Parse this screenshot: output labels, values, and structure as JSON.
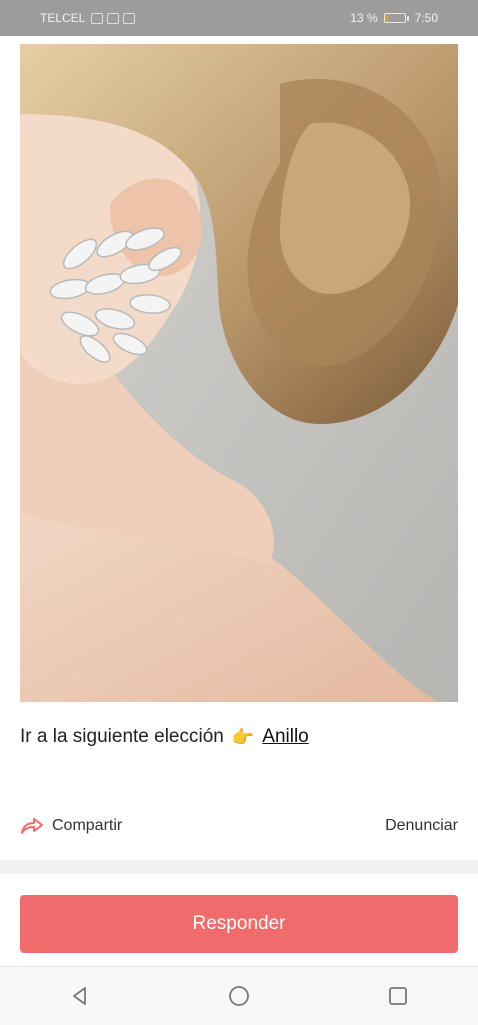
{
  "status_bar": {
    "carrier": "TELCEL",
    "battery_percent": "13 %",
    "battery_level": 0.13,
    "time": "7:50"
  },
  "post": {
    "image_alt": "woman with earring",
    "text": "Ir a la siguiente elección",
    "emoji": "👉",
    "link_label": "Anillo"
  },
  "actions": {
    "share_label": "Compartir",
    "report_label": "Denunciar"
  },
  "reply_button_label": "Responder",
  "colors": {
    "accent": "#f06c6c",
    "statusbar": "#9c9c9c"
  },
  "icons": {
    "share": "share-arrow-icon",
    "back": "nav-back-icon",
    "home": "nav-home-icon",
    "recents": "nav-recents-icon"
  }
}
